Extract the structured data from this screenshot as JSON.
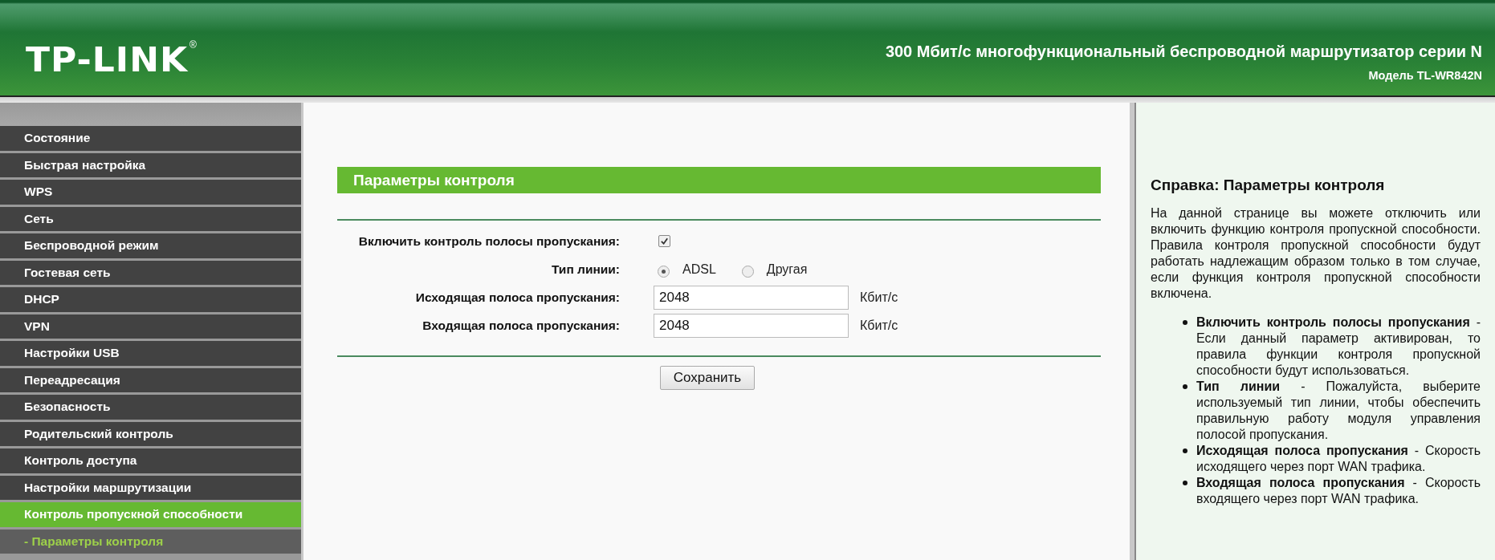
{
  "header": {
    "logo": "TP-LINK",
    "logo_mark": "®",
    "title": "300 Мбит/с многофункциональный беспроводной маршрутизатор серии N",
    "model": "Модель TL-WR842N"
  },
  "sidebar": {
    "items": [
      {
        "label": "Состояние",
        "selected": false
      },
      {
        "label": "Быстрая настройка",
        "selected": false
      },
      {
        "label": "WPS",
        "selected": false
      },
      {
        "label": "Сеть",
        "selected": false
      },
      {
        "label": "Беспроводной режим",
        "selected": false
      },
      {
        "label": "Гостевая сеть",
        "selected": false
      },
      {
        "label": "DHCP",
        "selected": false
      },
      {
        "label": "VPN",
        "selected": false
      },
      {
        "label": "Настройки USB",
        "selected": false
      },
      {
        "label": "Переадресация",
        "selected": false
      },
      {
        "label": "Безопасность",
        "selected": false
      },
      {
        "label": "Родительский контроль",
        "selected": false
      },
      {
        "label": "Контроль доступа",
        "selected": false
      },
      {
        "label": "Настройки маршрутизации",
        "selected": false
      },
      {
        "label": "Контроль пропускной способности",
        "selected": true,
        "children": [
          {
            "label": "- Параметры контроля",
            "selected": true
          }
        ]
      }
    ]
  },
  "main": {
    "title": "Параметры контроля",
    "enable": {
      "label": "Включить контроль полосы пропускания:",
      "checked": true
    },
    "line_type": {
      "label": "Тип линии:",
      "options": [
        {
          "label": "ADSL",
          "selected": true
        },
        {
          "label": "Другая",
          "selected": false
        }
      ]
    },
    "fields": [
      {
        "label": "Исходящая полоса пропускания:",
        "value": "2048",
        "unit": "Кбит/с"
      },
      {
        "label": "Входящая полоса пропускания:",
        "value": "2048",
        "unit": "Кбит/с"
      }
    ],
    "save_button": "Сохранить"
  },
  "help": {
    "title": "Справка: Параметры контроля",
    "intro": "На данной странице вы можете отключить или включить функцию контроля пропускной способности. Правила контроля пропускной способности будут работать надлежащим образом только в том случае, если функция контроля пропускной способности включена.",
    "items": [
      "**Включить контроль полосы пропускания** - Если данный параметр активирован, то правила функции контроля пропускной способности будут использоваться.",
      "**Тип линии** - Пожалуйста, выберите используемый тип линии, чтобы обеспечить правильную работу модуля управления полосой пропускания.",
      "**Исходящая полоса пропускания** - Скорость исходящего через порт WAN трафика.",
      "**Входящая полоса пропускания** - Скорость входящего через порт WAN трафика."
    ]
  }
}
